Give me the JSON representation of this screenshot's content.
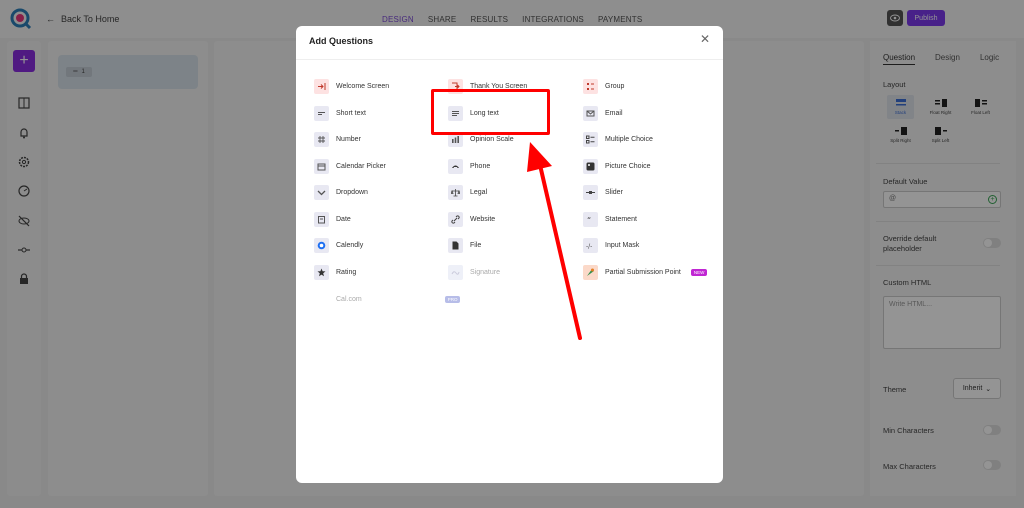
{
  "topbar": {
    "back_label": "Back To Home",
    "tabs": [
      {
        "label": "DESIGN",
        "active": true
      },
      {
        "label": "SHARE",
        "active": false
      },
      {
        "label": "RESULTS",
        "active": false
      },
      {
        "label": "INTEGRATIONS",
        "active": false
      },
      {
        "label": "PAYMENTS",
        "active": false
      }
    ],
    "publish_label": "Publish"
  },
  "question_list": {
    "item_number": "1"
  },
  "right_panel": {
    "tabs": [
      "Question",
      "Design",
      "Logic"
    ],
    "active_tab": "Question",
    "layout_label": "Layout",
    "layout_options": [
      "Stack",
      "Float Right",
      "Float Left",
      "Split Right",
      "Split Left"
    ],
    "selected_layout": "Stack",
    "default_value_label": "Default Value",
    "default_value_placeholder": "@",
    "override_label": "Override default placeholder",
    "custom_html_label": "Custom HTML",
    "custom_html_placeholder": "Write HTML...",
    "theme_label": "Theme",
    "theme_value": "Inherit",
    "min_chars_label": "Min Characters",
    "max_chars_label": "Max Characters"
  },
  "modal": {
    "title": "Add Questions",
    "columns": [
      [
        {
          "label": "Welcome Screen",
          "icon": "welcome-icon",
          "color": "#fde2e2"
        },
        {
          "label": "Short text",
          "icon": "short-text-icon",
          "color": "#e8e8f2"
        },
        {
          "label": "Number",
          "icon": "hash-icon",
          "color": "#e8e8f2"
        },
        {
          "label": "Calendar Picker",
          "icon": "calendar-icon",
          "color": "#e8e8f2"
        },
        {
          "label": "Dropdown",
          "icon": "dropdown-icon",
          "color": "#e8e8f2"
        },
        {
          "label": "Date",
          "icon": "date-icon",
          "color": "#e8e8f2"
        },
        {
          "label": "Calendly",
          "icon": "calendly-icon",
          "color": "#e8e8f2"
        },
        {
          "label": "Rating",
          "icon": "star-icon",
          "color": "#e8e8f2"
        },
        {
          "label": "Cal.com",
          "icon": "",
          "color": "#ffffff",
          "badge": "PRO"
        }
      ],
      [
        {
          "label": "Thank You Screen",
          "icon": "thank-you-icon",
          "color": "#fde2e2"
        },
        {
          "label": "Long text",
          "icon": "long-text-icon",
          "color": "#e8e8f2"
        },
        {
          "label": "Opinion Scale",
          "icon": "opinion-scale-icon",
          "color": "#e8e8f2"
        },
        {
          "label": "Phone",
          "icon": "phone-icon",
          "color": "#e8e8f2"
        },
        {
          "label": "Legal",
          "icon": "legal-icon",
          "color": "#e8e8f2"
        },
        {
          "label": "Website",
          "icon": "link-icon",
          "color": "#e8e8f2"
        },
        {
          "label": "File",
          "icon": "file-icon",
          "color": "#e8e8f2"
        },
        {
          "label": "Signature",
          "icon": "signature-icon",
          "color": "#eef0f8"
        }
      ],
      [
        {
          "label": "Group",
          "icon": "group-icon",
          "color": "#fde2e2"
        },
        {
          "label": "Email",
          "icon": "email-icon",
          "color": "#e8e8f2"
        },
        {
          "label": "Multiple Choice",
          "icon": "multiple-choice-icon",
          "color": "#e8e8f2"
        },
        {
          "label": "Picture Choice",
          "icon": "picture-choice-icon",
          "color": "#e8e8f2"
        },
        {
          "label": "Slider",
          "icon": "slider-icon",
          "color": "#e8e8f2"
        },
        {
          "label": "Statement",
          "icon": "quote-icon",
          "color": "#e8e8f2"
        },
        {
          "label": "Input Mask",
          "icon": "input-mask-icon",
          "color": "#e8e8f2"
        },
        {
          "label": "Partial Submission Point",
          "icon": "partial-submission-icon",
          "color": "#fbd9c9",
          "badge": "NEW"
        }
      ]
    ]
  },
  "colors": {
    "accent": "#7c3aed",
    "highlight": "#ff0000"
  }
}
